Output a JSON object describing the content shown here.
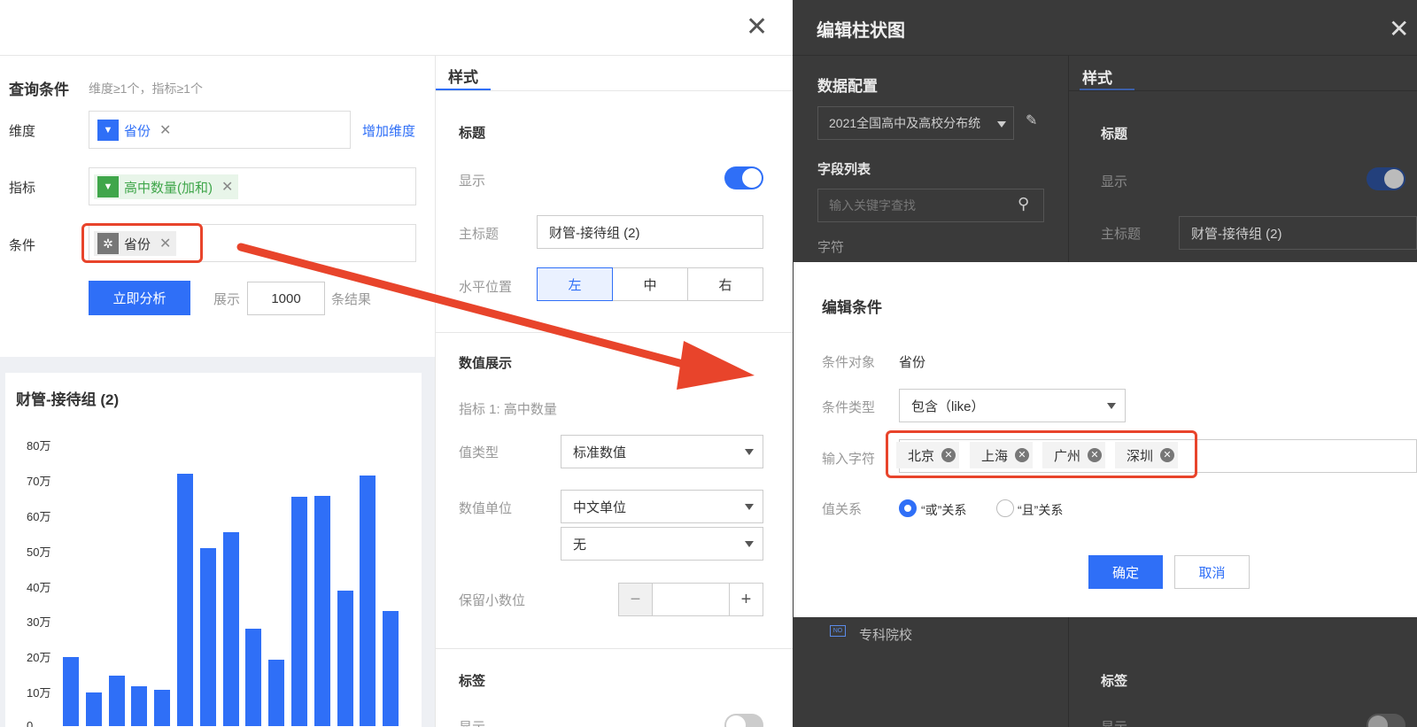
{
  "left_panel": {
    "close_icon": "close-icon",
    "query": {
      "title": "查询条件",
      "hint": "维度≥1个，指标≥1个",
      "dimension_label": "维度",
      "dimension_chip": "省份",
      "add_dimension": "增加维度",
      "metric_label": "指标",
      "metric_chip": "高中数量(加和)",
      "condition_label": "条件",
      "condition_chip": "省份",
      "analyze_button": "立即分析",
      "show_label": "展示",
      "show_count": "1000",
      "results_suffix": "条结果"
    },
    "style": {
      "tab": "样式",
      "title_section": "标题",
      "show_label": "显示",
      "main_title_label": "主标题",
      "main_title_value": "财管-接待组 (2)",
      "h_position_label": "水平位置",
      "h_positions": [
        "左",
        "中",
        "右"
      ],
      "values_section": "数值展示",
      "metric_line": "指标 1: 高中数量",
      "value_type_label": "值类型",
      "value_type": "标准数值",
      "value_unit_label": "数值单位",
      "value_unit": "中文单位",
      "value_unit_sub": "无",
      "decimals_label": "保留小数位",
      "decimals_value": "",
      "minus": "−",
      "plus": "+",
      "label_section": "标签",
      "label_show": "显示"
    }
  },
  "chart_data": {
    "type": "bar",
    "title": "财管-接待组 (2)",
    "ylim": [
      0,
      800000
    ],
    "yticks": [
      "80万",
      "70万",
      "60万",
      "50万",
      "40万",
      "30万",
      "20万",
      "10万",
      "0"
    ],
    "values": [
      195000,
      95000,
      142000,
      113000,
      103000,
      715000,
      505000,
      548000,
      275000,
      187000,
      649000,
      652000,
      384000,
      710000,
      326000
    ],
    "color": "#2f6ff7",
    "grid": false
  },
  "right_panel": {
    "title": "编辑柱状图",
    "data_config": "数据配置",
    "dataset": "2021全国高中及高校分布统",
    "field_list": "字段列表",
    "search_placeholder": "输入关键字查找",
    "string_group": "字符",
    "style_tab": "样式",
    "title_section": "标题",
    "show_label": "显示",
    "main_title_label": "主标题",
    "main_title_value": "财管-接待组 (2)",
    "college_item": "专科院校",
    "college_badge": "NO",
    "label_section": "标签",
    "label_show": "显示"
  },
  "dialog": {
    "title": "编辑条件",
    "object_label": "条件对象",
    "object_value": "省份",
    "type_label": "条件类型",
    "type_value": "包含（like）",
    "input_label": "输入字符",
    "tags": [
      "北京",
      "上海",
      "广州",
      "深圳"
    ],
    "relation_label": "值关系",
    "or_option": "“或”关系",
    "and_option": "“且”关系",
    "confirm": "确定",
    "cancel": "取消"
  },
  "colors": {
    "accent": "#2f6ff7",
    "highlight": "#e8442b",
    "metric_green": "#3fa64a"
  }
}
